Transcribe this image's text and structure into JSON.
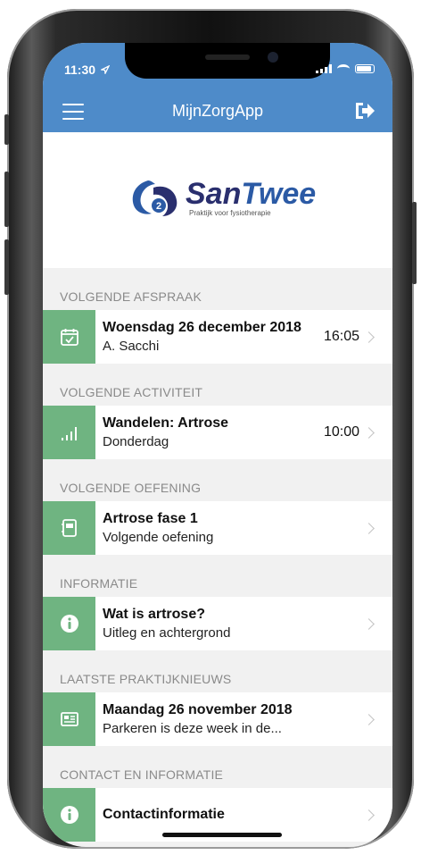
{
  "status_bar": {
    "time": "11:30"
  },
  "header": {
    "title": "MijnZorgApp"
  },
  "logo": {
    "name_part1": "San",
    "name_part2": "Twee",
    "tagline": "Praktijk voor fysiotherapie"
  },
  "sections": [
    {
      "header": "VOLGENDE AFSPRAAK",
      "title": "Woensdag 26 december 2018",
      "subtitle": "A. Sacchi",
      "time": "16:05",
      "icon": "calendar-check-icon"
    },
    {
      "header": "VOLGENDE ACTIVITEIT",
      "title": "Wandelen: Artrose",
      "subtitle": "Donderdag",
      "time": "10:00",
      "icon": "signal-bars-icon"
    },
    {
      "header": "VOLGENDE OEFENING",
      "title": "Artrose fase 1",
      "subtitle": "Volgende oefening",
      "time": "",
      "icon": "notebook-icon"
    },
    {
      "header": "INFORMATIE",
      "title": "Wat is artrose?",
      "subtitle": "Uitleg en achtergrond",
      "time": "",
      "icon": "info-icon"
    },
    {
      "header": "LAATSTE PRAKTIJKNIEUWS",
      "title": "Maandag 26 november 2018",
      "subtitle": "Parkeren is deze week in de...",
      "time": "",
      "icon": "newspaper-icon"
    },
    {
      "header": "CONTACT EN INFORMATIE",
      "title": "Contactinformatie",
      "subtitle": "",
      "time": "",
      "icon": "info-icon"
    }
  ],
  "colors": {
    "header_bg": "#4e8bc9",
    "icon_bg": "#6fb481",
    "section_bg": "#f1f1f1"
  }
}
